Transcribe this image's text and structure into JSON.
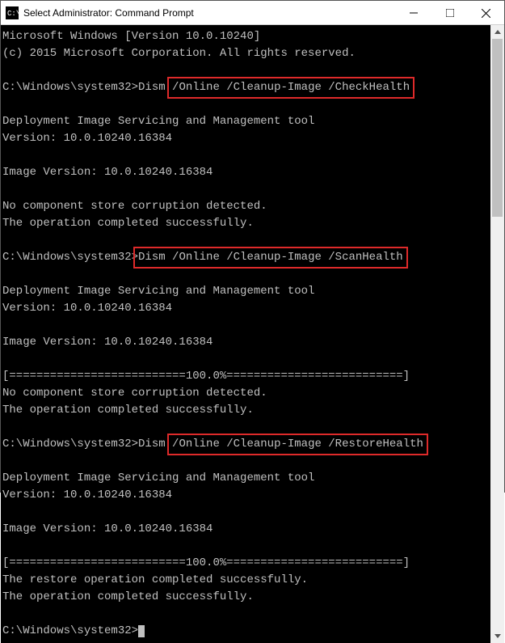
{
  "titlebar": {
    "title": "Select Administrator: Command Prompt"
  },
  "terminal": {
    "lines": {
      "l1": "Microsoft Windows [Version 10.0.10240]",
      "l2": "(c) 2015 Microsoft Corporation. All rights reserved.",
      "prompt": "C:\\Windows\\system32>",
      "cmd1_prefix": "Dism ",
      "cmd1_hl": "/Online /Cleanup-Image /CheckHealth",
      "tool_line": "Deployment Image Servicing and Management tool",
      "version_line": "Version: 10.0.10240.16384",
      "image_version": "Image Version: 10.0.10240.16384",
      "no_corruption": "No component store corruption detected.",
      "op_success": "The operation completed successfully.",
      "cmd2_hl": "Dism /Online /Cleanup-Image /ScanHealth",
      "progress": "[==========================100.0%==========================]",
      "cmd3_prefix": "Dism ",
      "cmd3_hl": "/Online /Cleanup-Image /RestoreHealth",
      "restore_success": "The restore operation completed successfully."
    }
  }
}
